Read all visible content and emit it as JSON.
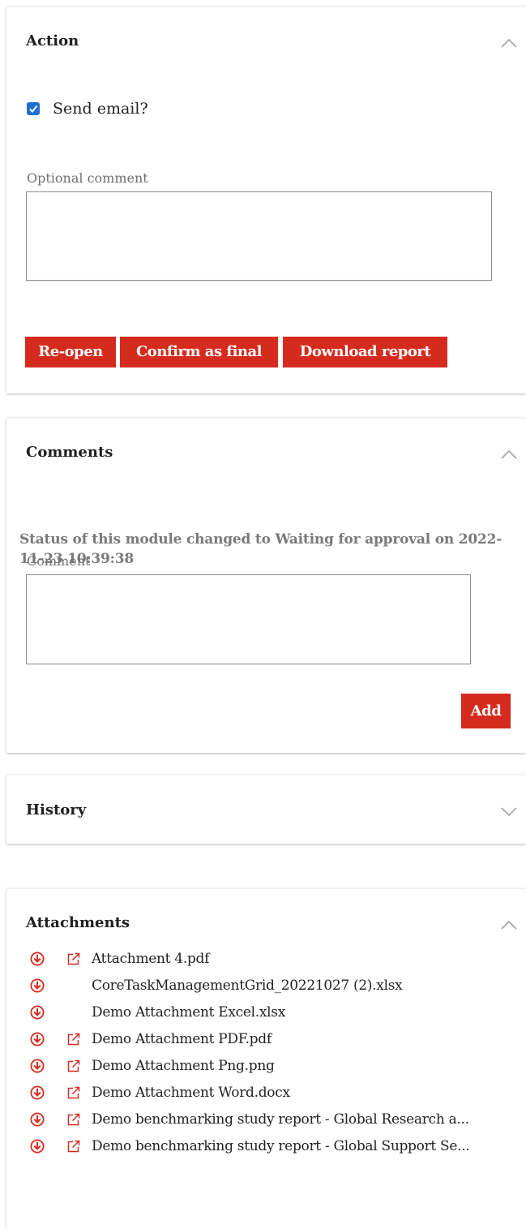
{
  "action": {
    "title": "Action",
    "send_email_label": "Send email?",
    "send_email_checked": true,
    "comment_label": "Optional comment",
    "comment_value": "",
    "buttons": {
      "reopen": "Re-open",
      "confirm": "Confirm as final",
      "download": "Download report"
    }
  },
  "comments": {
    "title": "Comments",
    "status_message": "Status of this module changed to Waiting for approval on 2022-11-23 10:39:38",
    "comment_label": "Comment",
    "comment_value": "",
    "add_label": "Add"
  },
  "history": {
    "title": "History",
    "collapsed": true
  },
  "attachments": {
    "title": "Attachments",
    "items": [
      {
        "name": "Attachment 4.pdf",
        "has_external_link": true
      },
      {
        "name": "CoreTaskManagementGrid_20221027 (2).xlsx",
        "has_external_link": false
      },
      {
        "name": "Demo Attachment Excel.xlsx",
        "has_external_link": false
      },
      {
        "name": "Demo Attachment PDF.pdf",
        "has_external_link": true
      },
      {
        "name": "Demo Attachment Png.png",
        "has_external_link": true
      },
      {
        "name": "Demo Attachment Word.docx",
        "has_external_link": true
      },
      {
        "name": "Demo benchmarking study report - Global Research a...",
        "has_external_link": true
      },
      {
        "name": "Demo benchmarking study report - Global Support Se...",
        "has_external_link": true
      }
    ]
  },
  "colors": {
    "accent": "#d52b1e",
    "checkbox": "#1f6fd1",
    "muted_text": "#7a7a7a"
  },
  "icons": {
    "collapse": "chevron-up-icon",
    "expand": "chevron-down-icon",
    "download": "download-circle-icon",
    "open": "external-link-icon"
  }
}
